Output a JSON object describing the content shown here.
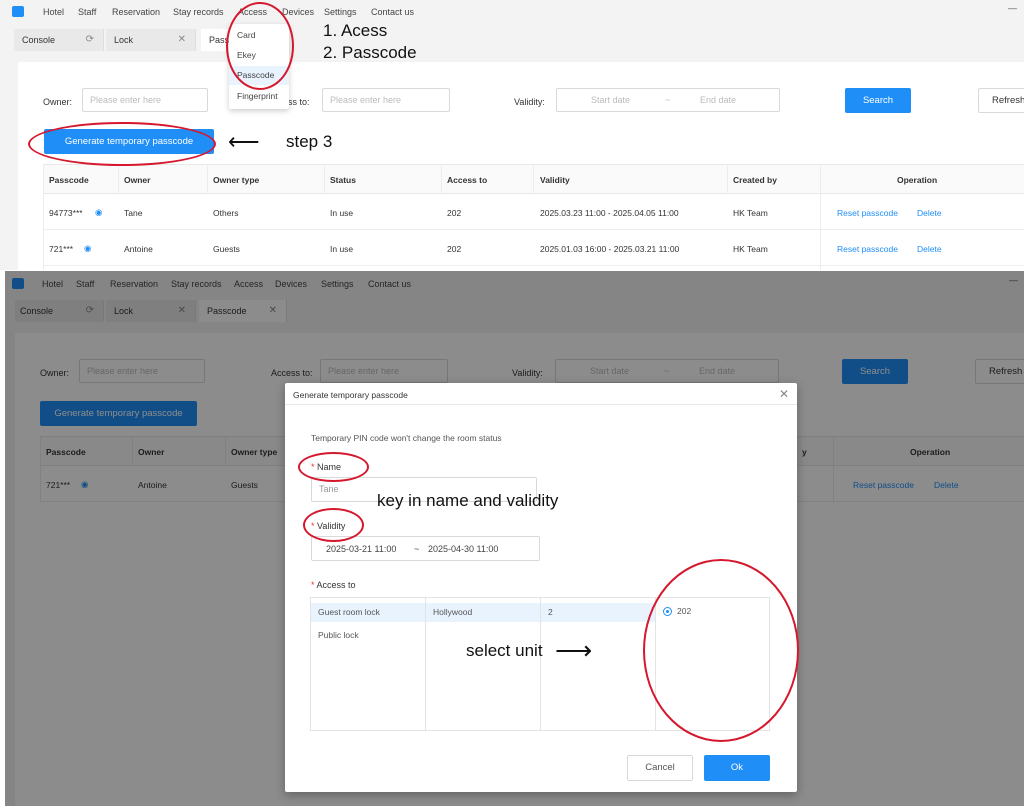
{
  "menu": {
    "items": [
      "Hotel",
      "Staff",
      "Reservation",
      "Stay records",
      "Access",
      "Devices",
      "Settings",
      "Contact us"
    ],
    "access_dropdown": [
      "Card",
      "Ekey",
      "Passcode",
      "Fingerprint"
    ]
  },
  "tabs": [
    {
      "label": "Console",
      "icon": "refresh-icon"
    },
    {
      "label": "Lock",
      "icon": "close-icon"
    },
    {
      "label": "Passcode",
      "icon": "close-icon"
    }
  ],
  "top_tab3_partial": "Passc",
  "window_minimize": "—",
  "filters": {
    "owner_label": "Owner:",
    "owner_placeholder": "Please enter here",
    "access_label_partial": "ess to:",
    "access_label": "Access to:",
    "access_placeholder": "Please enter here",
    "validity_label": "Validity:",
    "start_placeholder": "Start date",
    "range_sep": "~",
    "end_placeholder": "End date",
    "search_label": "Search",
    "refresh_label": "Refresh"
  },
  "generate_button": "Generate temporary passcode",
  "table": {
    "columns": [
      "Passcode",
      "Owner",
      "Owner type",
      "Status",
      "Access to",
      "Validity",
      "Created by",
      "Operation"
    ],
    "rows": [
      {
        "passcode": "94773***",
        "owner": "Tane",
        "owner_type": "Others",
        "status": "In use",
        "access_to": "202",
        "validity": "2025.03.23 11:00 - 2025.04.05 11:00",
        "created_by": "HK Team",
        "op1": "Reset passcode",
        "op2": "Delete"
      },
      {
        "passcode": "721***",
        "owner": "Antoine",
        "owner_type": "Guests",
        "status": "In use",
        "access_to": "202",
        "validity": "2025.01.03 16:00 - 2025.03.21 11:00",
        "created_by": "HK Team",
        "op1": "Reset passcode",
        "op2": "Delete"
      }
    ],
    "bottom_partial_col": "y"
  },
  "modal": {
    "title": "Generate temporary passcode",
    "hint": "Temporary PIN code won't change the room status",
    "name_label": "Name",
    "name_value": "Tane",
    "validity_label": "Validity",
    "validity_start": "2025-03-21 11:00",
    "validity_sep": "~",
    "validity_end": "2025-04-30 11:00",
    "access_label": "Access to",
    "lock_types": [
      "Guest room lock",
      "Public lock"
    ],
    "building": "Hollywood",
    "floor": "2",
    "room": "202",
    "cancel_label": "Cancel",
    "ok_label": "Ok",
    "required_mark": "*"
  },
  "annotations": {
    "step12_line1": "1. Acess",
    "step12_line2": "2. Passcode",
    "step3": "step 3",
    "key_in": "key in name and validity",
    "select_unit": "select unit",
    "arrow_left": "⟵",
    "arrow_right": "⟶"
  },
  "colors": {
    "primary": "#1f8ef7",
    "annotation_red": "#d5182d"
  }
}
